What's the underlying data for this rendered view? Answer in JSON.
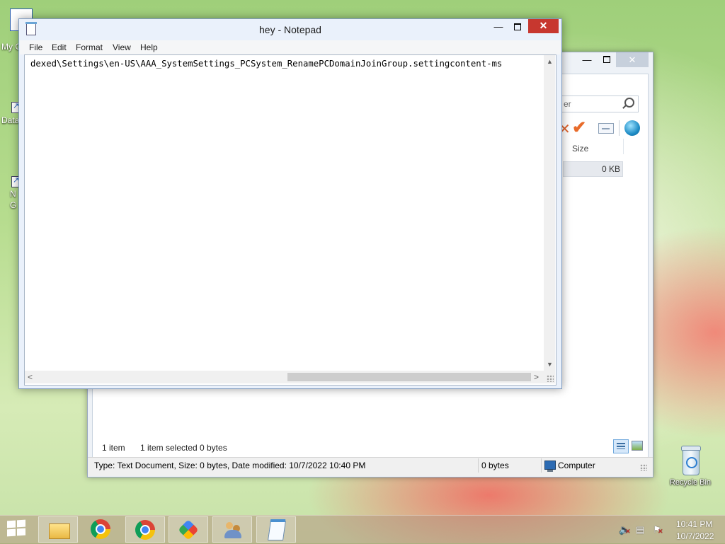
{
  "desktop": {
    "partial_icons": [
      {
        "label": "My C"
      },
      {
        "label": "Data"
      },
      {
        "label": "N"
      },
      {
        "label": "G"
      }
    ],
    "recycle_bin": {
      "label": "Recycle Bin"
    }
  },
  "explorer": {
    "search_placeholder": "er",
    "column_size": "Size",
    "row_size": "0 KB",
    "status_items": "1 item",
    "status_selected": "1 item selected",
    "status_bytes": "0 bytes",
    "statusbar_type": "Type: Text Document, Size: 0 bytes, Date modified: 10/7/2022 10:40 PM",
    "statusbar_bytes": "0 bytes",
    "statusbar_location": "Computer",
    "min_glyph": "—",
    "close_glyph": "✕"
  },
  "notepad": {
    "title": "hey - Notepad",
    "menu": [
      "File",
      "Edit",
      "Format",
      "View",
      "Help"
    ],
    "content": "dexed\\Settings\\en-US\\AAA_SystemSettings_PCSystem_RenamePCDomainJoinGroup.settingcontent-ms",
    "min_glyph": "—",
    "close_glyph": "✕"
  },
  "taskbar": {
    "apps": [
      "file-explorer",
      "chrome",
      "chrome",
      "pinwheel-app",
      "users-app",
      "notepad"
    ],
    "clock_time": "10:41 PM",
    "clock_date": "10/7/2022"
  }
}
